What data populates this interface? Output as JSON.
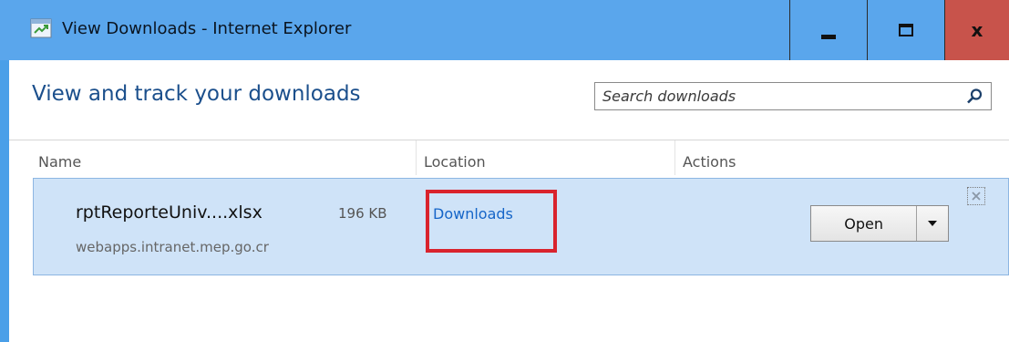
{
  "window": {
    "title": "View Downloads - Internet Explorer",
    "colors": {
      "titlebar": "#5aa6ec",
      "close": "#c8534b",
      "heading": "#1b4f8c",
      "link": "#1565c8",
      "row_selected": "#cfe3f8",
      "highlight": "#d9232d"
    }
  },
  "controls": {
    "minimize_icon": "minimize-icon",
    "maximize_icon": "maximize-icon",
    "close_label": "x"
  },
  "header": {
    "title": "View and track your downloads"
  },
  "search": {
    "placeholder": "Search downloads",
    "value": "",
    "icon": "search-icon"
  },
  "columns": {
    "name": "Name",
    "location": "Location",
    "actions": "Actions"
  },
  "downloads": [
    {
      "file_name": "rptReporteUniv....xlsx",
      "size": "196 KB",
      "source": "webapps.intranet.mep.go.cr",
      "location": "Downloads",
      "action": "Open"
    }
  ]
}
